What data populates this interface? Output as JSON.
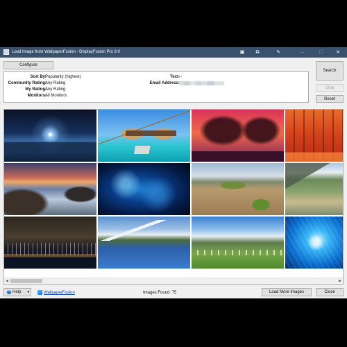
{
  "window": {
    "title": "Load Image from WallpaperFusion - DisplayFusion Pro 9.0",
    "controls": {
      "minimize": "—",
      "maximize": "☐",
      "close": "✕"
    },
    "toolbar_icons": [
      "monitor-icon",
      "window-icon",
      "pin-icon"
    ]
  },
  "toolbar": {
    "configure_label": "Configure"
  },
  "filters": {
    "sort_by": {
      "label": "Sort By:",
      "value": "Popularity (highest)"
    },
    "community_rating": {
      "label": "Community Rating:",
      "value": "Any Rating"
    },
    "my_rating": {
      "label": "My Rating:",
      "value": "Any Rating"
    },
    "monitors": {
      "label": "Monitors:",
      "value": "All Monitors"
    },
    "text": {
      "label": "Text:",
      "value": "--"
    },
    "email": {
      "label": "Email Address:"
    }
  },
  "actions": {
    "search_label": "Search",
    "stop_label": "Stop",
    "reset_label": "Reset"
  },
  "gallery": {
    "thumbnails": [
      {
        "name": "night-sky-lake"
      },
      {
        "name": "overwater-bungalows"
      },
      {
        "name": "red-trees"
      },
      {
        "name": "autumn-forest"
      },
      {
        "name": "coastal-sunset"
      },
      {
        "name": "blue-nebula"
      },
      {
        "name": "desert-dunes"
      },
      {
        "name": "mountain-lake-clouds"
      },
      {
        "name": "city-night-skyline"
      },
      {
        "name": "mountain-reflection"
      },
      {
        "name": "alpine-village"
      },
      {
        "name": "blue-lion"
      }
    ]
  },
  "footer": {
    "help_label": "Help",
    "wallpaperfusion_link": "WallpaperFusion",
    "images_found": "Images Found: 75",
    "load_more_label": "Load More Images",
    "close_label": "Close"
  }
}
